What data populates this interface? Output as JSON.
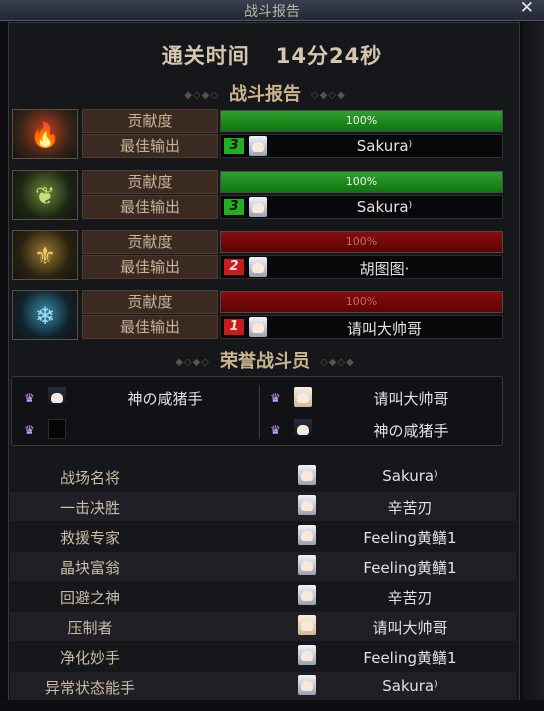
{
  "window": {
    "title": "战斗报告",
    "close_label": "✕"
  },
  "clear_time": {
    "label": "通关时间",
    "value": "14分24秒"
  },
  "battle_report": {
    "title": "战斗报告",
    "contribution_label": "贡献度",
    "best_output_label": "最佳输出",
    "players": [
      {
        "portrait": "red-flame-warrior-icon",
        "colors": [
          "#c04020",
          "#3a2418",
          "#ffb060"
        ],
        "glyph": "🔥",
        "contribution_percent": 100,
        "contribution_text": "100%",
        "bar_color": "green",
        "rank": "3",
        "rank_color": "green",
        "name": "Sakura⁾"
      },
      {
        "portrait": "green-wind-warrior-icon",
        "colors": [
          "#6b8a3a",
          "#1e2614",
          "#c8e080"
        ],
        "glyph": "❦",
        "contribution_percent": 100,
        "contribution_text": "100%",
        "bar_color": "green",
        "rank": "3",
        "rank_color": "green",
        "name": "Sakura⁾"
      },
      {
        "portrait": "gold-earth-warrior-icon",
        "colors": [
          "#9a7a30",
          "#2a2210",
          "#f0d070"
        ],
        "glyph": "⚜",
        "contribution_percent": 100,
        "contribution_text": "100%",
        "bar_color": "red",
        "rank": "2",
        "rank_color": "red",
        "name": "胡图图·"
      },
      {
        "portrait": "blue-ice-warrior-icon",
        "colors": [
          "#3a8aa8",
          "#10222a",
          "#9ee0ff"
        ],
        "glyph": "❄",
        "contribution_percent": 100,
        "contribution_text": "100%",
        "bar_color": "red",
        "rank": "1",
        "rank_color": "red",
        "name": "请叫大帅哥"
      }
    ]
  },
  "honor": {
    "title": "荣誉战斗员",
    "slots": [
      {
        "name": "神の咸猪手",
        "avatar": "dark"
      },
      {
        "name": "请叫大帅哥",
        "avatar": "light"
      },
      {
        "name": "",
        "avatar": "empty"
      },
      {
        "name": "神の咸猪手",
        "avatar": "dark"
      }
    ]
  },
  "awards": [
    {
      "title": "战场名将",
      "player": "Sakura⁾",
      "avatar": "white"
    },
    {
      "title": "一击决胜",
      "player": "辛苦刃",
      "avatar": "white"
    },
    {
      "title": "救援专家",
      "player": "Feeling黄鳝1",
      "avatar": "white"
    },
    {
      "title": "晶块富翁",
      "player": "Feeling黄鳝1",
      "avatar": "white"
    },
    {
      "title": "回避之神",
      "player": "辛苦刃",
      "avatar": "white"
    },
    {
      "title": "压制者",
      "player": "请叫大帅哥",
      "avatar": "light"
    },
    {
      "title": "净化妙手",
      "player": "Feeling黄鳝1",
      "avatar": "white"
    },
    {
      "title": "异常状态能手",
      "player": "Sakura⁾",
      "avatar": "white"
    }
  ]
}
